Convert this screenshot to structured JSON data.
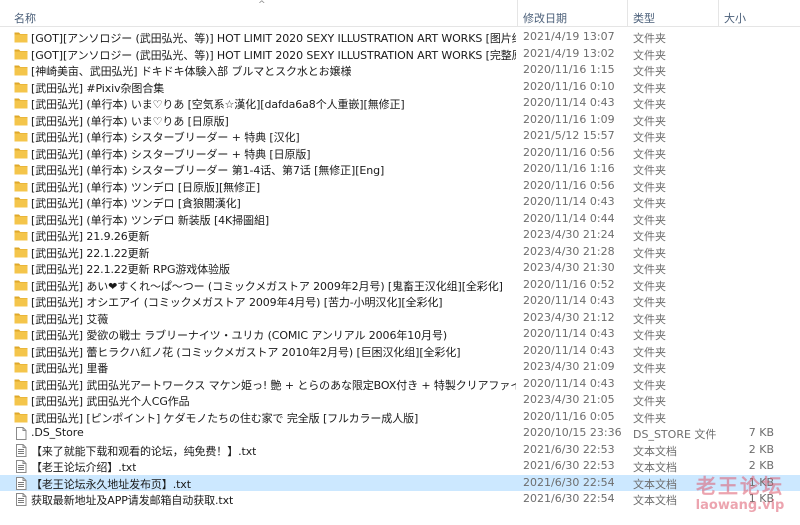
{
  "columns": {
    "name": "名称",
    "date": "修改日期",
    "type": "类型",
    "size": "大小"
  },
  "rows": [
    {
      "kind": "folder",
      "name": "[GOT][アンソロジー (武田弘光、等)] HOT LIMIT 2020 SEXY ILLUSTRATION ART WORKS [图片纯享版]",
      "date": "2021/4/19 13:07",
      "type": "文件夹",
      "size": ""
    },
    {
      "kind": "folder",
      "name": "[GOT][アンソロジー (武田弘光、等)] HOT LIMIT 2020 SEXY ILLUSTRATION ART WORKS [完整原版]",
      "date": "2021/4/19 13:02",
      "type": "文件夹",
      "size": ""
    },
    {
      "kind": "folder",
      "name": "[神崎美亩、武田弘光] ドキドキ体験入部 ブルマとスク水とお嬢様",
      "date": "2020/11/16 1:15",
      "type": "文件夹",
      "size": ""
    },
    {
      "kind": "folder",
      "name": "[武田弘光] #Pixiv杂图合集",
      "date": "2020/11/16 0:10",
      "type": "文件夹",
      "size": ""
    },
    {
      "kind": "folder",
      "name": "[武田弘光] (单行本) いま♡りあ [空気系☆漢化][dafda6a8个人重嵌][無修正]",
      "date": "2020/11/14 0:43",
      "type": "文件夹",
      "size": ""
    },
    {
      "kind": "folder",
      "name": "[武田弘光] (单行本) いま♡りあ [日原版]",
      "date": "2020/11/16 1:09",
      "type": "文件夹",
      "size": ""
    },
    {
      "kind": "folder",
      "name": "[武田弘光] (单行本) シスターブリーダー + 特典 [汉化]",
      "date": "2021/5/12 15:57",
      "type": "文件夹",
      "size": ""
    },
    {
      "kind": "folder",
      "name": "[武田弘光] (单行本) シスターブリーダー + 特典 [日原版]",
      "date": "2020/11/16 0:56",
      "type": "文件夹",
      "size": ""
    },
    {
      "kind": "folder",
      "name": "[武田弘光] (单行本) シスターブリーダー 第1-4话、第7话 [無修正][Eng]",
      "date": "2020/11/16 1:16",
      "type": "文件夹",
      "size": ""
    },
    {
      "kind": "folder",
      "name": "[武田弘光] (单行本) ツンデロ [日原版][無修正]",
      "date": "2020/11/16 0:56",
      "type": "文件夹",
      "size": ""
    },
    {
      "kind": "folder",
      "name": "[武田弘光] (单行本) ツンデロ [貪狼閣漢化]",
      "date": "2020/11/14 0:43",
      "type": "文件夹",
      "size": ""
    },
    {
      "kind": "folder",
      "name": "[武田弘光] (单行本) ツンデロ 新装版 [4K掃圖組]",
      "date": "2020/11/14 0:44",
      "type": "文件夹",
      "size": ""
    },
    {
      "kind": "folder",
      "name": "[武田弘光] 21.9.26更新",
      "date": "2023/4/30 21:24",
      "type": "文件夹",
      "size": ""
    },
    {
      "kind": "folder",
      "name": "[武田弘光] 22.1.22更新",
      "date": "2023/4/30 21:28",
      "type": "文件夹",
      "size": ""
    },
    {
      "kind": "folder",
      "name": "[武田弘光] 22.1.22更新 RPG游戏体验版",
      "date": "2023/4/30 21:30",
      "type": "文件夹",
      "size": ""
    },
    {
      "kind": "folder",
      "name": "[武田弘光] あい❤すくれ～ぱ～つー (コミックメガストア 2009年2月号) [鬼畜王汉化组][全彩化]",
      "date": "2020/11/16 0:52",
      "type": "文件夹",
      "size": ""
    },
    {
      "kind": "folder",
      "name": "[武田弘光] オシエアイ (コミックメガストア 2009年4月号) [苦力-小明汉化][全彩化]",
      "date": "2020/11/14 0:43",
      "type": "文件夹",
      "size": ""
    },
    {
      "kind": "folder",
      "name": "[武田弘光] 艾薇",
      "date": "2023/4/30 21:12",
      "type": "文件夹",
      "size": ""
    },
    {
      "kind": "folder",
      "name": "[武田弘光] 愛欲の戦士 ラブリーナイツ・ユリカ (COMIC アンリアル 2006年10月号)",
      "date": "2020/11/14 0:43",
      "type": "文件夹",
      "size": ""
    },
    {
      "kind": "folder",
      "name": "[武田弘光] 蕾ヒラクハ紅ノ花 (コミックメガストア 2010年2月号) [巨困汉化组][全彩化]",
      "date": "2020/11/14 0:43",
      "type": "文件夹",
      "size": ""
    },
    {
      "kind": "folder",
      "name": "[武田弘光] 里番",
      "date": "2023/4/30 21:09",
      "type": "文件夹",
      "size": ""
    },
    {
      "kind": "folder",
      "name": "[武田弘光] 武田弘光アートワークス マケン姫っ! 艶 + とらのあな限定BOX付き + 特製クリアファイル",
      "date": "2020/11/14 0:43",
      "type": "文件夹",
      "size": ""
    },
    {
      "kind": "folder",
      "name": "[武田弘光] 武田弘光个人CG作品",
      "date": "2023/4/30 21:05",
      "type": "文件夹",
      "size": ""
    },
    {
      "kind": "folder",
      "name": "[武田弘光] [ピンポイント] ケダモノたちの住む家で 完全版 [フルカラー成人版]",
      "date": "2020/11/16 0:05",
      "type": "文件夹",
      "size": ""
    },
    {
      "kind": "blank",
      "name": ".DS_Store",
      "date": "2020/10/15 23:36",
      "type": "DS_STORE 文件",
      "size": "7 KB"
    },
    {
      "kind": "text",
      "name": "【来了就能下载和观看的论坛，纯免费！】.txt",
      "date": "2021/6/30 22:53",
      "type": "文本文档",
      "size": "2 KB"
    },
    {
      "kind": "text",
      "name": "【老王论坛介绍】.txt",
      "date": "2021/6/30 22:53",
      "type": "文本文档",
      "size": "2 KB"
    },
    {
      "kind": "text",
      "name": "【老王论坛永久地址发布页】.txt",
      "date": "2021/6/30 22:54",
      "type": "文本文档",
      "size": "1 KB",
      "selected": true
    },
    {
      "kind": "text",
      "name": "获取最新地址及APP请发邮箱自动获取.txt",
      "date": "2021/6/30 22:54",
      "type": "文本文档",
      "size": "1 KB"
    }
  ],
  "watermark": {
    "line1": "老王论坛",
    "line2": "laowang.vip"
  },
  "colors": {
    "folder": "#f4c54b",
    "selected_row": "#cce8ff",
    "header_text": "#4c607a"
  }
}
